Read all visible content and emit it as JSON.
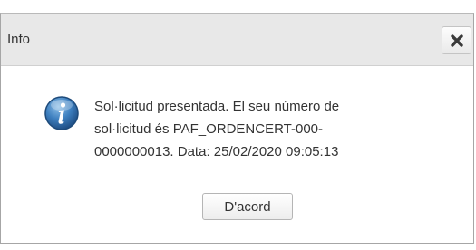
{
  "dialog": {
    "title": "Info",
    "close_icon": "close-x-icon",
    "status_icon": "info-icon",
    "message_lines": [
      "Sol·licitud presentada. El seu número de",
      "sol·licitud és PAF_ORDENCERT-000-",
      "0000000013. Data: 25/02/2020 09:05:13"
    ],
    "ok_label": "D'acord"
  },
  "colors": {
    "titlebar": "#e8e8e8",
    "text": "#333333",
    "info_icon": "#2f6ea8"
  }
}
